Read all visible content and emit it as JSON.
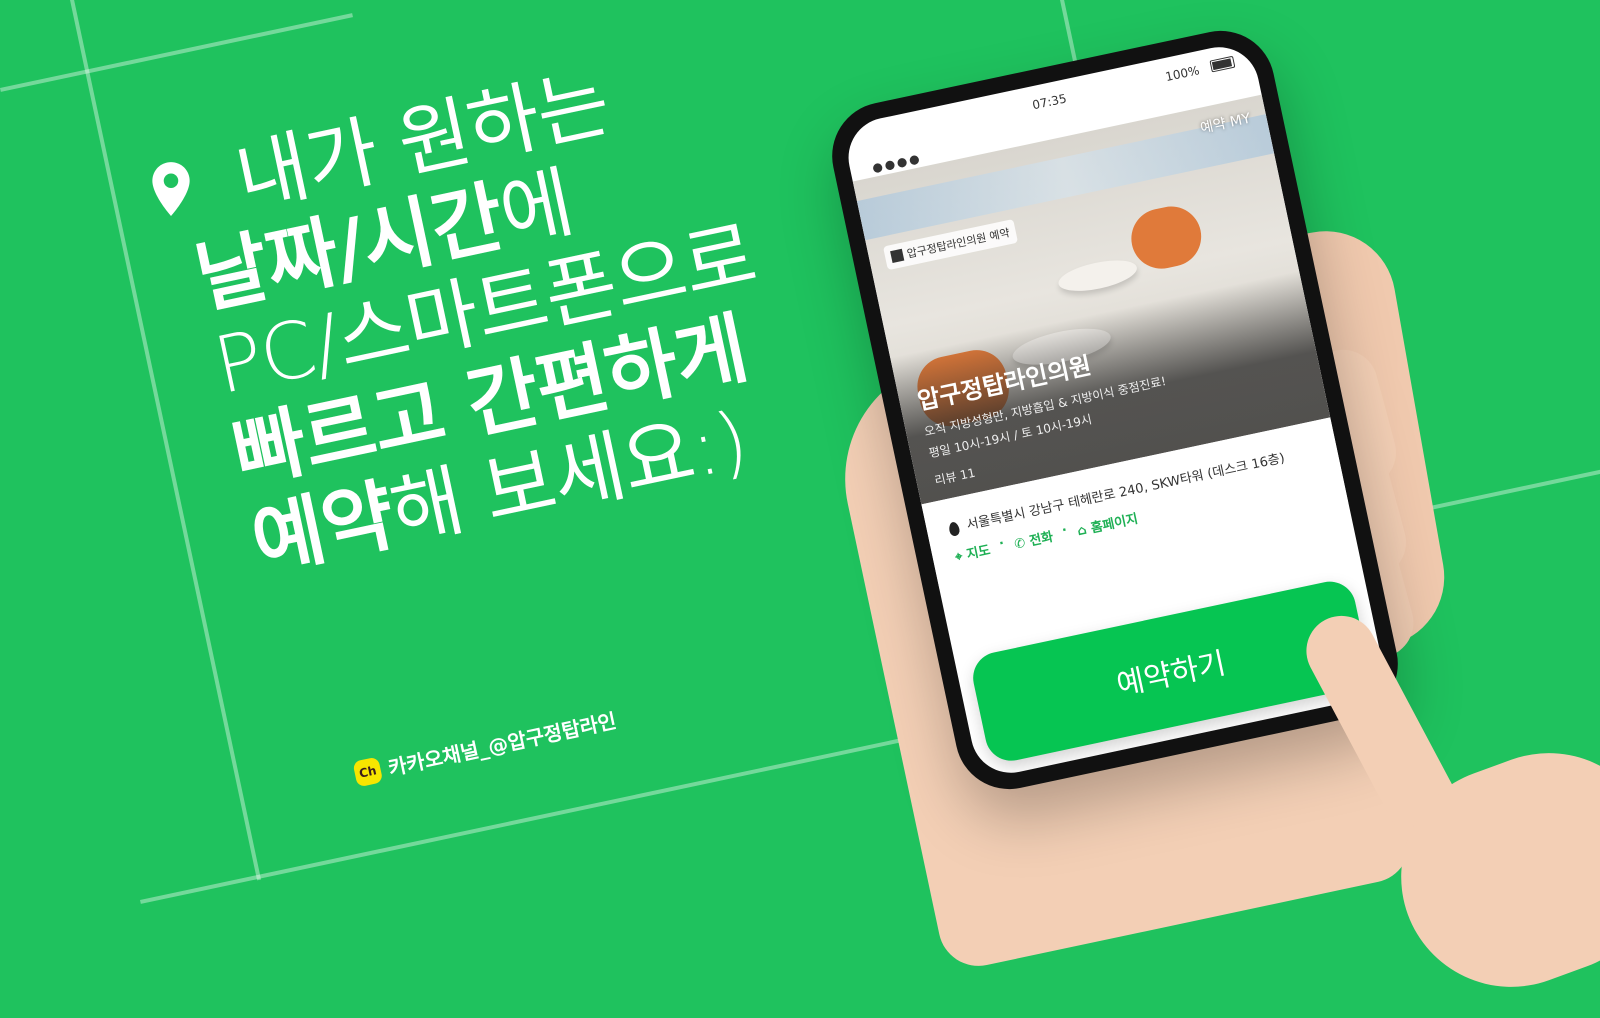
{
  "headline": {
    "line1": "내가 원하는",
    "line2_bold": "날짜/시간",
    "line2_rest": "에",
    "line3": "PC/스마트폰으로",
    "line4": "빠르고 간편하게",
    "line5_bold": "예약",
    "line5_rest": "해 보세요:)"
  },
  "kakao": {
    "badge": "Ch",
    "label": "카카오채널_@압구정탑라인"
  },
  "phone": {
    "time": "07:35",
    "battery": "100%",
    "nav_link": "예약 MY",
    "logo_text": "압구정탑라인의원 예약",
    "clinic_name": "압구정탑라인의원",
    "description": "오직 지방성형만, 지방흡입 & 지방이식 중점진료!",
    "hours": "평일 10시-19시 / 토 10시-19시",
    "reviews": "리뷰 11",
    "address": "서울특별시 강남구 테헤란로 240, SKW타워 (데스크 16층)",
    "links": {
      "map": "지도",
      "phone": "전화",
      "homepage": "홈페이지"
    },
    "book_button": "예약하기"
  },
  "colors": {
    "background": "#1fc25e",
    "accent": "#06c552",
    "kakao": "#f7e600"
  }
}
